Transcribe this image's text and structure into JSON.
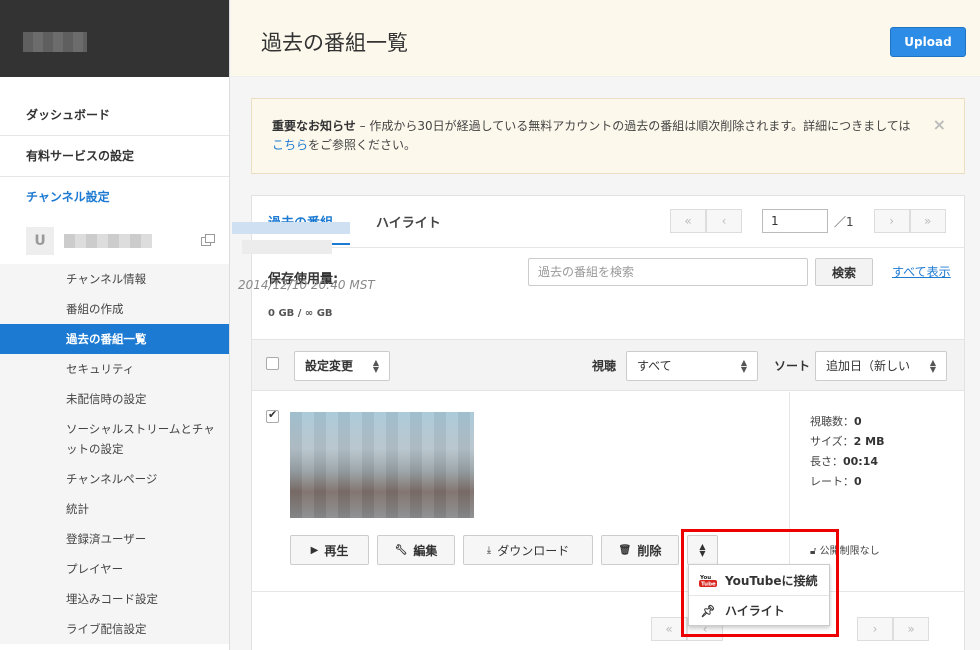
{
  "sidebar": {
    "main_items": [
      {
        "label": "ダッシュボード"
      },
      {
        "label": "有料サービスの設定"
      },
      {
        "label": "チャンネル設定"
      }
    ],
    "channel_initial": "U",
    "sub_items": [
      {
        "label": "チャンネル情報"
      },
      {
        "label": "番組の作成"
      },
      {
        "label": "過去の番組一覧"
      },
      {
        "label": "セキュリティ"
      },
      {
        "label": "未配信時の設定"
      },
      {
        "label": "ソーシャルストリームとチャットの設定"
      },
      {
        "label": "チャンネルページ"
      },
      {
        "label": "統計"
      },
      {
        "label": "登録済ユーザー"
      },
      {
        "label": "プレイヤー"
      },
      {
        "label": "埋込みコード設定"
      },
      {
        "label": "ライブ配信設定"
      }
    ]
  },
  "header": {
    "title": "過去の番組一覧",
    "upload_label": "Upload"
  },
  "notice": {
    "bold": "重要なお知らせ",
    "text1": " – 作成から30日が経過している無料アカウントの過去の番組は順次削除されます。詳細につきましてはこちらをご参照ください。",
    "before_link": " – 作成から30日が経過している無料アカウントの過去の番組は順次削除されます。詳細につきましては",
    "link": "こちら",
    "after_link": "をご参照ください。",
    "close": "×"
  },
  "tabs": [
    {
      "label": "過去の番組"
    },
    {
      "label": "ハイライト"
    }
  ],
  "pager": {
    "first": "«",
    "prev": "‹",
    "next": "›",
    "last": "»",
    "current": "1",
    "total": "／1"
  },
  "storage": {
    "label": "保存使用量:",
    "value": "0 GB / ∞ GB"
  },
  "search": {
    "placeholder": "過去の番組を検索",
    "button": "検索",
    "show_all": "すべて表示"
  },
  "filters": {
    "bulk_action": "設定変更",
    "view_label": "視聴",
    "view_value": "すべて",
    "sort_label": "ソート",
    "sort_value": "追加日（新しい"
  },
  "item": {
    "date": "2014/12/10 20:40 MST",
    "views_label": "視聴数：",
    "views": "0",
    "size_label": "サイズ：",
    "size": "2 MB",
    "length_label": "長さ：",
    "length": "00:14",
    "rate_label": "レート：",
    "rate": "0",
    "privacy": "公開制限なし",
    "actions": {
      "play": "再生",
      "edit": "編集",
      "download": "ダウンロード",
      "delete": "削除"
    }
  },
  "dropdown": {
    "youtube": "YouTubeに接続",
    "highlight": "ハイライト",
    "yt_icon_text": "You Tube"
  },
  "colors": {
    "accent": "#1d7ad2",
    "upload": "#2d8de6",
    "highlight_border": "#e00000"
  }
}
